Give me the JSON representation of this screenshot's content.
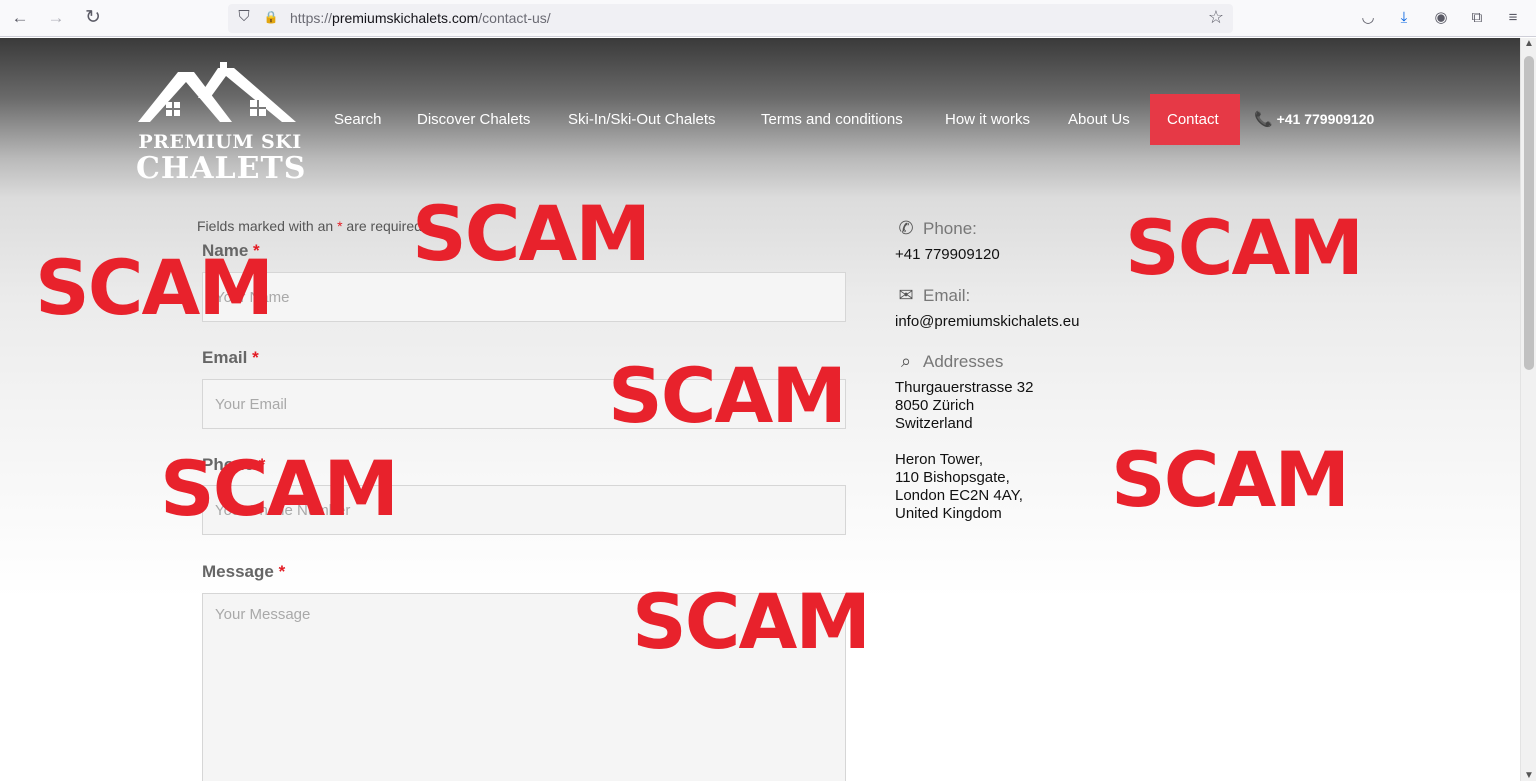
{
  "browser": {
    "url_prefix": "https://",
    "url_host": "premiumskichalets.com",
    "url_path": "/contact-us/",
    "back_icon": "←",
    "forward_icon": "→",
    "reload_icon": "↻",
    "shield_icon": "⛉",
    "lock_icon": "🔒",
    "star_icon": "☆",
    "pocket_icon": "◡",
    "download_icon": "⤓",
    "account_icon": "◉",
    "extensions_icon": "⧉",
    "menu_icon": "≡"
  },
  "site": {
    "logo_line1": "PREMIUM SKI",
    "logo_line2": "CHALETS",
    "nav": [
      {
        "label": "Search"
      },
      {
        "label": "Discover Chalets"
      },
      {
        "label": "Ski-In/Ski-Out Chalets"
      },
      {
        "label": "Terms and conditions"
      },
      {
        "label": "How it works"
      },
      {
        "label": "About Us"
      },
      {
        "label": "Contact"
      }
    ],
    "phone_icon": "📞",
    "phone": "+41 779909120"
  },
  "form": {
    "note_prefix": "Fields marked with an ",
    "note_star": "*",
    "note_suffix": " are required",
    "required_marker": "*",
    "name_label": "Name",
    "name_placeholder": "Your Name",
    "email_label": "Email",
    "email_placeholder": "Your Email",
    "phone_label": "Phone",
    "phone_placeholder": "Your Phone Number",
    "message_label": "Message",
    "message_placeholder": "Your Message"
  },
  "contact_info": {
    "phone_label": "Phone:",
    "phone_value": "+41 779909120",
    "email_label": "Email:",
    "email_value": "info@premiumskichalets.eu",
    "addresses_label": "Addresses",
    "address1": [
      "Thurgauerstrasse 32",
      "8050 Zürich",
      "Switzerland"
    ],
    "address2": [
      "Heron Tower,",
      "110 Bishopsgate,",
      "London EC2N 4AY,",
      "United Kingdom"
    ]
  },
  "overlay": {
    "stamp_text": "SCAM"
  },
  "colors": {
    "accent": "#e63946",
    "stamp": "#e8222c"
  }
}
